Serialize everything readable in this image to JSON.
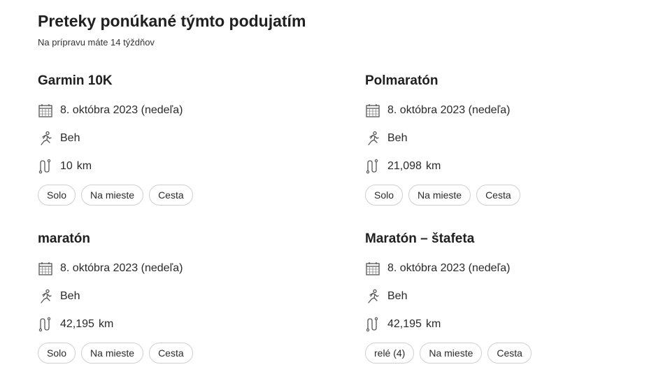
{
  "header": {
    "title": "Preteky ponúkané týmto podujatím",
    "subtitle": "Na prípravu máte 14 týždňov"
  },
  "races": [
    {
      "name": "Garmin 10K",
      "date": "8. októbra 2023 (nedeľa)",
      "sport": "Beh",
      "distance": "10",
      "unit": "km",
      "chips": [
        "Solo",
        "Na mieste",
        "Cesta"
      ]
    },
    {
      "name": "Polmaratón",
      "date": "8. októbra 2023 (nedeľa)",
      "sport": "Beh",
      "distance": "21,098",
      "unit": "km",
      "chips": [
        "Solo",
        "Na mieste",
        "Cesta"
      ]
    },
    {
      "name": "maratón",
      "date": "8. októbra 2023 (nedeľa)",
      "sport": "Beh",
      "distance": "42,195",
      "unit": "km",
      "chips": [
        "Solo",
        "Na mieste",
        "Cesta"
      ]
    },
    {
      "name": "Maratón – štafeta",
      "date": "8. októbra 2023 (nedeľa)",
      "sport": "Beh",
      "distance": "42,195",
      "unit": "km",
      "chips": [
        "relé (4)",
        "Na mieste",
        "Cesta"
      ]
    }
  ],
  "icons": {
    "date": "calendar-icon",
    "sport": "runner-icon",
    "distance": "route-icon"
  }
}
